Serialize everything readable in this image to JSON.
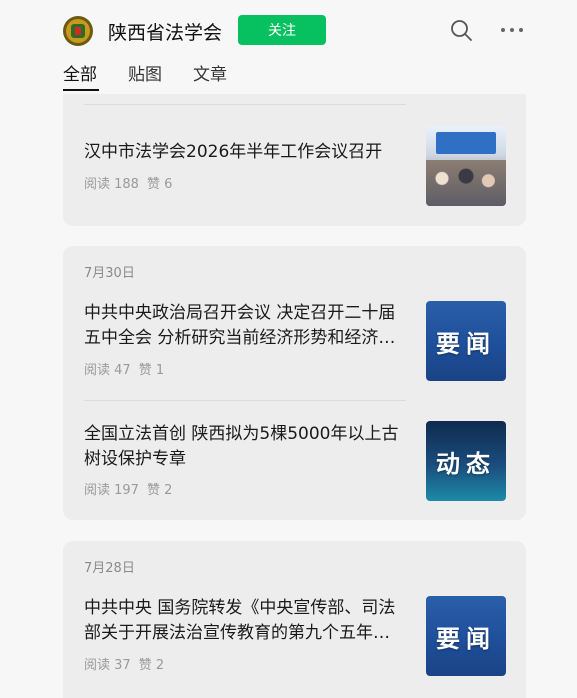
{
  "header": {
    "account_name": "陕西省法学会",
    "follow_label": "关注",
    "icons": [
      "logo-avatar",
      "search-icon",
      "more-icon"
    ]
  },
  "tabs": [
    {
      "label": "全部",
      "active": true
    },
    {
      "label": "贴图",
      "active": false
    },
    {
      "label": "文章",
      "active": false
    }
  ],
  "groups": [
    {
      "date": "",
      "items": [
        {
          "title": "汉中市法学会2026年半年工作会议召开",
          "reads": "阅读 188",
          "likes": "赞 6",
          "thumb": "photo"
        }
      ]
    },
    {
      "date": "7月30日",
      "items": [
        {
          "title": "中共中央政治局召开会议 决定召开二十届五中全会 分析研究当前经济形势和经济…",
          "reads": "阅读 47",
          "likes": "赞 1",
          "thumb": "要闻"
        },
        {
          "title": "全国立法首创 陕西拟为5棵5000年以上古树设保护专章",
          "reads": "阅读 197",
          "likes": "赞 2",
          "thumb": "动态"
        }
      ]
    },
    {
      "date": "7月28日",
      "items": [
        {
          "title": "中共中央 国务院转发《中央宣传部、司法部关于开展法治宣传教育的第九个五年…",
          "reads": "阅读 37",
          "likes": "赞 2",
          "thumb": "要闻"
        }
      ]
    }
  ],
  "colors": {
    "accent": "#07c160",
    "card": "#ededee",
    "background": "#f7f7f8"
  }
}
